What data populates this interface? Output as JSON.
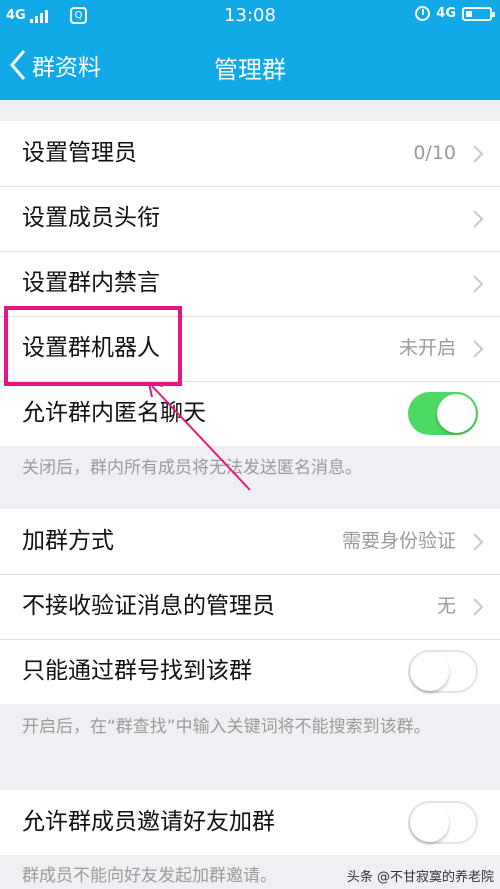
{
  "status_bar": {
    "network_left": "4G",
    "time": "13:08",
    "network_right": "4G",
    "icons": [
      "signal-bars-icon",
      "qq-notification-icon",
      "alarm-icon",
      "battery-icon"
    ]
  },
  "nav": {
    "back_label": "群资料",
    "title": "管理群"
  },
  "group1": [
    {
      "label": "设置管理员",
      "value": "0/10"
    },
    {
      "label": "设置成员头衔",
      "value": ""
    },
    {
      "label": "设置群内禁言",
      "value": ""
    },
    {
      "label": "设置群机器人",
      "value": "未开启"
    },
    {
      "label": "允许群内匿名聊天",
      "toggle": true
    }
  ],
  "note1": "关闭后，群内所有成员将无法发送匿名消息。",
  "group2": [
    {
      "label": "加群方式",
      "value": "需要身份验证"
    },
    {
      "label": "不接收验证消息的管理员",
      "value": "无"
    },
    {
      "label": "只能通过群号找到该群",
      "toggle": false
    }
  ],
  "note2": "开启后，在“群查找”中输入关键词将不能搜索到该群。",
  "group3": [
    {
      "label": "允许群成员邀请好友加群",
      "toggle": false
    }
  ],
  "note3": "群成员不能向好友发起加群邀请。",
  "watermark": "头条 @不甘寂寞的养老院",
  "colors": {
    "header_blue": "#12a9e8",
    "toggle_on_green": "#4cd964",
    "annotation_pink": "#e6157f"
  }
}
